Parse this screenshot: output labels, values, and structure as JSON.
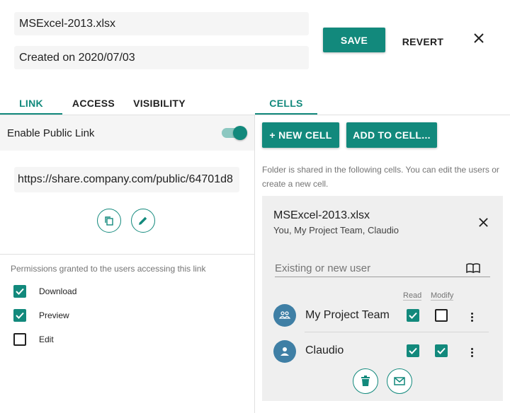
{
  "header": {
    "filename": "MSExcel-2013.xlsx",
    "created": "Created on 2020/07/03",
    "save_label": "SAVE",
    "revert_label": "REVERT",
    "close_icon": "close-icon"
  },
  "left_tabs": [
    {
      "label": "LINK",
      "active": true
    },
    {
      "label": "ACCESS",
      "active": false
    },
    {
      "label": "VISIBILITY",
      "active": false
    }
  ],
  "right_tabs": [
    {
      "label": "CELLS",
      "active": true
    }
  ],
  "link": {
    "enable_label": "Enable Public Link",
    "enabled": true,
    "url": "https://share.company.com/public/64701d8",
    "copy_icon": "copy-icon",
    "edit_icon": "pencil-icon"
  },
  "permissions": {
    "heading": "Permissions granted to the users accessing this link",
    "items": [
      {
        "label": "Download",
        "checked": true
      },
      {
        "label": "Preview",
        "checked": true
      },
      {
        "label": "Edit",
        "checked": false
      }
    ]
  },
  "cells": {
    "new_cell_label": "+ NEW CELL",
    "add_to_cell_label": "ADD TO CELL...",
    "info": "Folder is shared in the following cells. You can edit the users or create a new cell.",
    "card": {
      "title": "MSExcel-2013.xlsx",
      "subtitle": "You, My Project Team, Claudio",
      "user_placeholder": "Existing or new user",
      "col_read": "Read",
      "col_modify": "Modify",
      "members": [
        {
          "name": "My Project Team",
          "type": "team",
          "read": true,
          "modify": false
        },
        {
          "name": "Claudio",
          "type": "user",
          "read": true,
          "modify": true
        }
      ],
      "delete_icon": "trash-icon",
      "mail_icon": "mail-icon"
    }
  },
  "colors": {
    "accent": "#12897c",
    "avatar": "#3f7fa5",
    "panel": "#efefef"
  }
}
